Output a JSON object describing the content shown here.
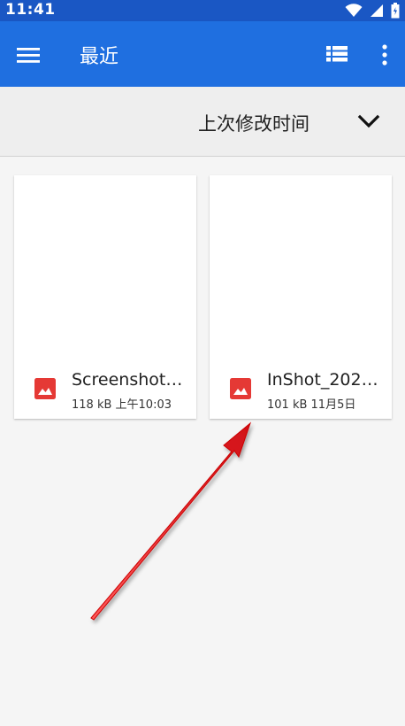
{
  "status_bar": {
    "time": "11:41",
    "icons": [
      "wifi-icon",
      "signal-icon",
      "battery-icon"
    ]
  },
  "toolbar": {
    "title": "最近",
    "menu_icon": "menu-icon",
    "view_icon": "list-view-icon",
    "more_icon": "more-vert-icon"
  },
  "sort": {
    "label": "上次修改时间",
    "chevron_icon": "chevron-down-icon"
  },
  "files": [
    {
      "name": "Screenshot…",
      "meta": "118 kB 上午10:03",
      "icon": "image-icon"
    },
    {
      "name": "InShot_202…",
      "meta": "101 kB 11月5日",
      "icon": "image-icon"
    }
  ],
  "colors": {
    "status_bar": "#1a57c4",
    "toolbar": "#1f6fe0",
    "image_icon": "#e53935",
    "arrow": "#e0141b"
  }
}
